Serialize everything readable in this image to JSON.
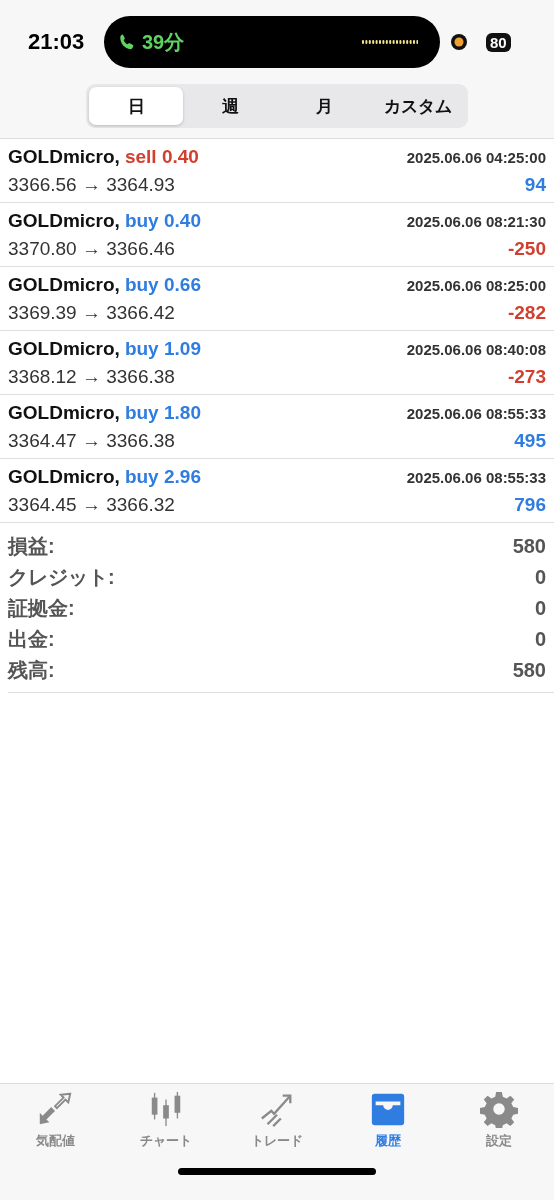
{
  "status_bar": {
    "time": "21:03",
    "call_duration": "39分",
    "battery": "80"
  },
  "tabs": [
    {
      "label": "日",
      "selected": true
    },
    {
      "label": "週",
      "selected": false
    },
    {
      "label": "月",
      "selected": false
    },
    {
      "label": "カスタム",
      "selected": false
    }
  ],
  "trades": [
    {
      "symbol": "GOLDmicro,",
      "side": "sell 0.40",
      "kind": "sell",
      "time": "2025.06.06 04:25:00",
      "prices": "3366.56 → 3364.93",
      "profit": {
        "text": "94",
        "kind": "gain"
      }
    },
    {
      "symbol": "GOLDmicro,",
      "side": "buy 0.40",
      "kind": "buy",
      "time": "2025.06.06 08:21:30",
      "prices": "3370.80 → 3366.46",
      "profit": {
        "text": "-250",
        "kind": "loss"
      }
    },
    {
      "symbol": "GOLDmicro,",
      "side": "buy 0.66",
      "kind": "buy",
      "time": "2025.06.06 08:25:00",
      "prices": "3369.39 → 3366.42",
      "profit": {
        "text": "-282",
        "kind": "loss"
      }
    },
    {
      "symbol": "GOLDmicro,",
      "side": "buy 1.09",
      "kind": "buy",
      "time": "2025.06.06 08:40:08",
      "prices": "3368.12 → 3366.38",
      "profit": {
        "text": "-273",
        "kind": "loss"
      }
    },
    {
      "symbol": "GOLDmicro,",
      "side": "buy 1.80",
      "kind": "buy",
      "time": "2025.06.06 08:55:33",
      "prices": "3364.47 → 3366.38",
      "profit": {
        "text": "495",
        "kind": "gain"
      }
    },
    {
      "symbol": "GOLDmicro,",
      "side": "buy 2.96",
      "kind": "buy",
      "time": "2025.06.06 08:55:33",
      "prices": "3364.45 → 3366.32",
      "profit": {
        "text": "796",
        "kind": "gain"
      }
    }
  ],
  "summary": [
    {
      "label": "損益:",
      "value": "580"
    },
    {
      "label": "クレジット:",
      "value": "0"
    },
    {
      "label": "証拠金:",
      "value": "0"
    },
    {
      "label": "出金:",
      "value": "0"
    },
    {
      "label": "残高:",
      "value": "580"
    }
  ],
  "bottom_nav": [
    {
      "label": "気配値",
      "selected": false
    },
    {
      "label": "チャート",
      "selected": false
    },
    {
      "label": "トレード",
      "selected": false
    },
    {
      "label": "履歴",
      "selected": true
    },
    {
      "label": "設定",
      "selected": false
    }
  ]
}
